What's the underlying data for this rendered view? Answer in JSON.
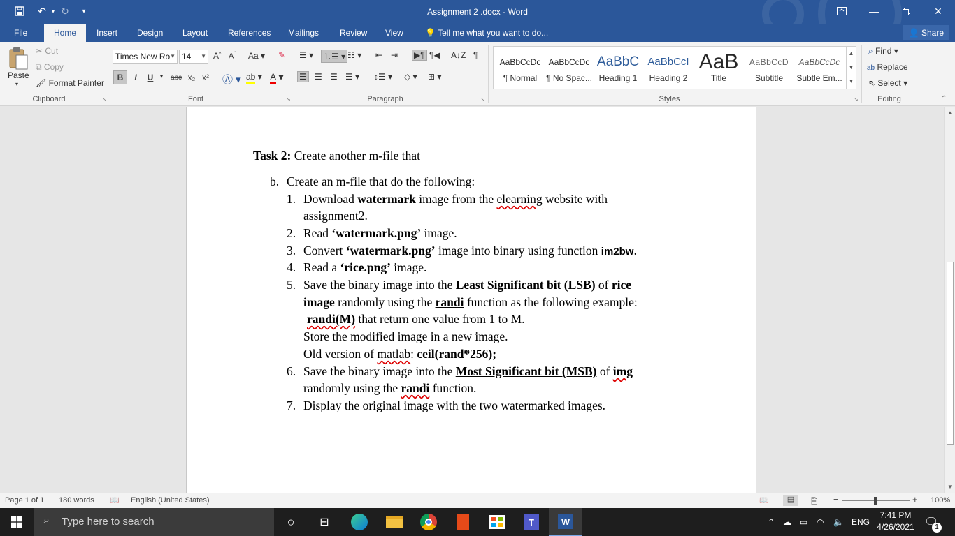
{
  "window": {
    "title": "Assignment 2 .docx - Word",
    "qat": {
      "save_icon": "save-icon",
      "undo_icon": "undo-icon",
      "redo_icon": "redo-icon",
      "customize_icon": "chevron-down-icon"
    }
  },
  "tabs": [
    {
      "label": "File"
    },
    {
      "label": "Home"
    },
    {
      "label": "Insert"
    },
    {
      "label": "Design"
    },
    {
      "label": "Layout"
    },
    {
      "label": "References"
    },
    {
      "label": "Mailings"
    },
    {
      "label": "Review"
    },
    {
      "label": "View"
    }
  ],
  "tell_me": "Tell me what you want to do...",
  "share": "Share",
  "ribbon": {
    "clipboard": {
      "paste": "Paste",
      "cut": "Cut",
      "copy": "Copy",
      "format_painter": "Format Painter",
      "label": "Clipboard"
    },
    "font": {
      "family": "Times New Ro",
      "size": "14",
      "label": "Font",
      "change_case": "Aa",
      "bold": "B",
      "italic": "I",
      "underline": "U",
      "strike": "abc",
      "sub": "x₂",
      "sup": "x²"
    },
    "paragraph": {
      "label": "Paragraph"
    },
    "styles": {
      "label": "Styles",
      "items": [
        {
          "sample": "AaBbCcDc",
          "name": "¶ Normal"
        },
        {
          "sample": "AaBbCcDc",
          "name": "¶ No Spac..."
        },
        {
          "sample": "AaBbC",
          "name": "Heading 1"
        },
        {
          "sample": "AaBbCcI",
          "name": "Heading 2"
        },
        {
          "sample": "AaB",
          "name": "Title"
        },
        {
          "sample": "AaBbCcD",
          "name": "Subtitle"
        },
        {
          "sample": "AaBbCcDc",
          "name": "Subtle Em..."
        }
      ]
    },
    "editing": {
      "label": "Editing",
      "find": "Find",
      "replace": "Replace",
      "select": "Select"
    }
  },
  "document": {
    "task_label": "Task 2: ",
    "task_text": "Create another m-file that",
    "item_b_marker": "b.",
    "item_b_text": "Create an m-file that do the following:",
    "list": {
      "n1": "1.",
      "l1a": "Download ",
      "l1b": "watermark",
      "l1c": " image from the ",
      "l1d": "elearning",
      "l1e": " website with",
      "l1f": "assignment2.",
      "n2": "2.",
      "l2a": "Read ",
      "l2b": "‘watermark.png’",
      "l2c": " image.",
      "n3": "3.",
      "l3a": "Convert ",
      "l3b": "‘watermark.png’",
      "l3c": " image into binary using function ",
      "l3d": "im2bw",
      "l3e": ".",
      "n4": "4.",
      "l4a": "Read a ",
      "l4b": "‘rice.png’",
      "l4c": " image.",
      "n5": "5.",
      "l5a": "Save the binary image into the ",
      "l5b": "Least Significant bit (LSB)",
      "l5c": " of ",
      "l5d": "rice",
      "l5e": "image",
      "l5f": " randomly using the ",
      "l5g": "randi",
      "l5h": " function as the following example:",
      "l5i": "randi(M)",
      "l5j": " that return one value from 1 to M.",
      "l5k": "Store the modified image in a new image.",
      "l5l": "Old version of ",
      "l5m": "matlab",
      "l5n": ": ",
      "l5o": "ceil(rand*256);",
      "n6": "6.",
      "l6a": "Save the binary image into the ",
      "l6b": "Most Significant bit (MSB)",
      "l6c": " of ",
      "l6d": "img",
      "l6e": "randomly using the ",
      "l6f": "randi",
      "l6g": " function.",
      "n7": "7.",
      "l7a": "Display the original image with the two watermarked images."
    }
  },
  "status": {
    "page": "Page 1 of 1",
    "words": "180 words",
    "language": "English (United States)",
    "zoom": "100%"
  },
  "taskbar": {
    "search_placeholder": "Type here to search",
    "time": "7:41 PM",
    "date": "4/26/2021",
    "lang": "ENG",
    "notifications": "1"
  },
  "colors": {
    "word_blue": "#2b579a",
    "taskbar": "#1e1e1e"
  }
}
